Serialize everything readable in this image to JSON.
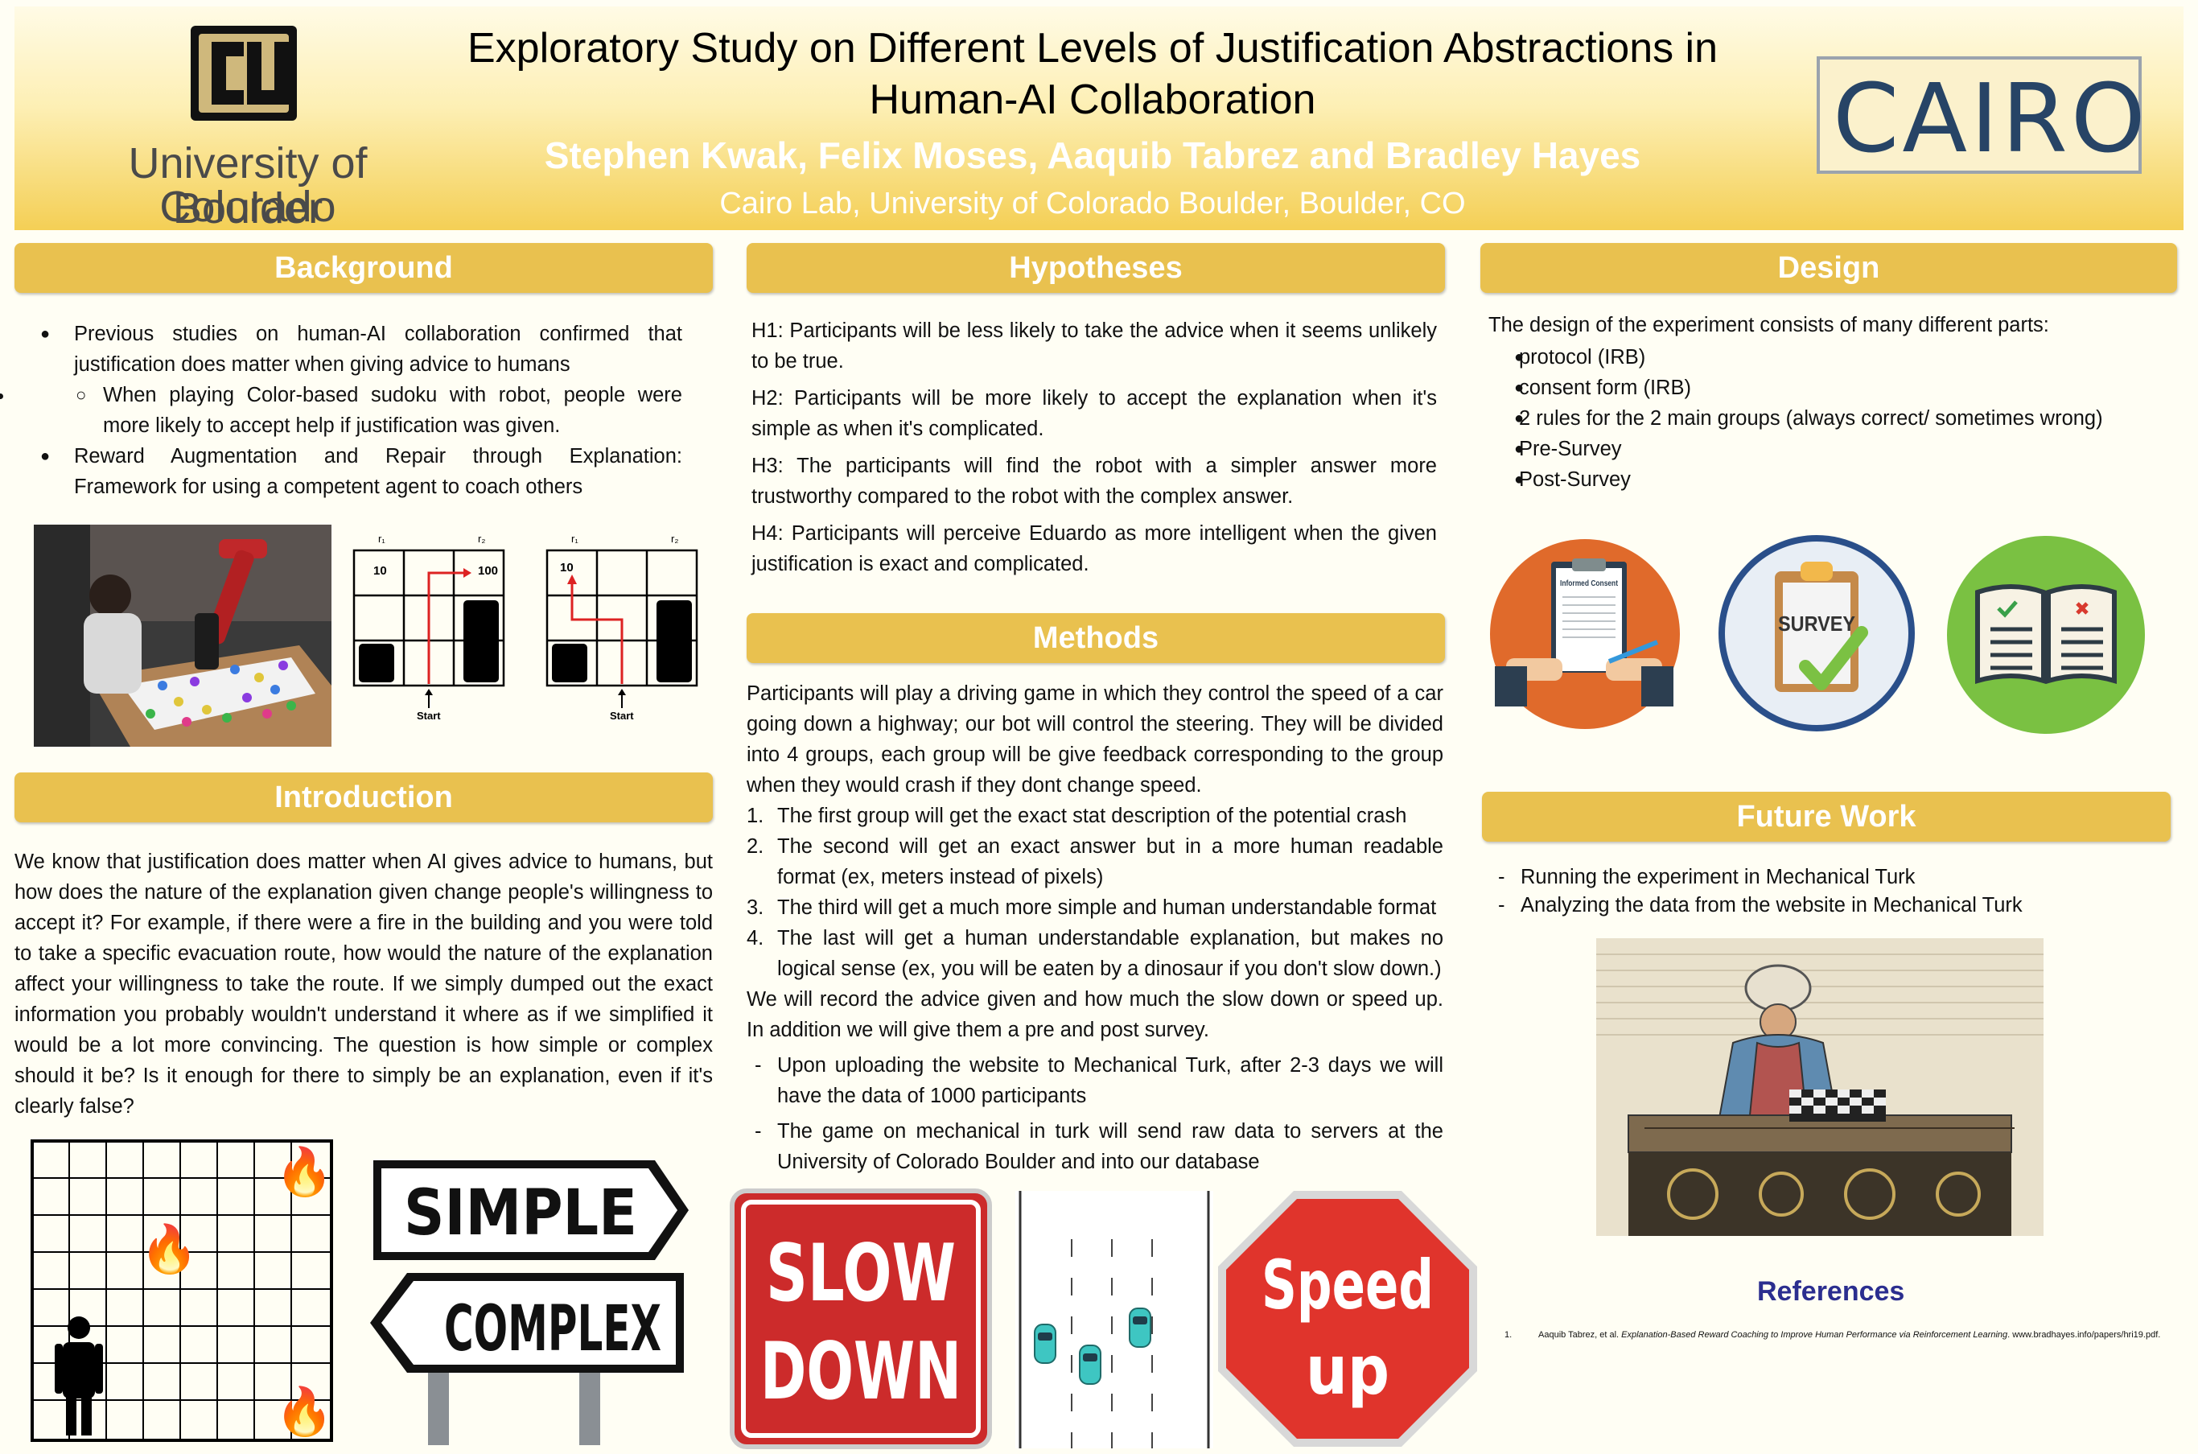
{
  "header": {
    "title": "Exploratory Study on Different Levels of Justification Abstractions in Human-AI Collaboration",
    "authors": "Stephen Kwak, Felix Moses, Aaquib Tabrez and Bradley Hayes",
    "affiliation": "Cairo Lab, University of Colorado Boulder, Boulder, CO",
    "left_logo_line1": "University of Colorado",
    "left_logo_line2": "Boulder",
    "right_logo": "CAIRO"
  },
  "background": {
    "heading": "Background",
    "bullet1": "Previous studies on human-AI collaboration confirmed that justification does matter when giving advice to humans",
    "sub1": "When playing Color-based sudoku with robot, people were more likely to accept help if justification was given.",
    "bullet2": "Reward Augmentation and Repair through Explanation: Framework for using a competent agent to coach others",
    "grid_labels": {
      "r1": "r₁",
      "r2": "r₂",
      "v10": "10",
      "v100": "100",
      "start": "Start"
    }
  },
  "introduction": {
    "heading": "Introduction",
    "text": "We know that justification does matter when AI gives advice to humans, but how does the nature of the explanation given change people's willingness to accept it? For example, if there were a fire in the building and you were told to take a specific evacuation route, how would the nature of the explanation affect your willingness to take the route. If we simply dumped out the exact information you probably wouldn't understand it where as if we simplified it would be a lot more convincing. The question is how simple or complex should it be? Is it enough for there to simply be an explanation, even if it's clearly false?",
    "sign_simple": "SIMPLE",
    "sign_complex": "COMPLEX",
    "fire_glyph": "🔥"
  },
  "hypotheses": {
    "heading": "Hypotheses",
    "items": [
      "H1: Participants will be less likely to take the advice when it seems unlikely to be true.",
      "H2: Participants will be more likely to accept the explanation when it's simple as when it's complicated.",
      "H3: The participants will find the robot with a simpler answer more trustworthy compared to the robot with the complex answer.",
      "H4: Participants will perceive Eduardo as more intelligent when the given justification is exact and complicated."
    ]
  },
  "methods": {
    "heading": "Methods",
    "intro": "Participants will play a driving game in which they control the speed of a car going down a highway; our bot will control the steering. They will be divided into 4 groups, each group will be give feedback corresponding to the group when they would crash if they dont change speed.",
    "list": [
      "The first group will get the exact stat description of the potential crash",
      "The second will get an exact answer but in a more human readable format (ex, meters instead of pixels)",
      "The third will get a much more simple and human understandable format",
      "The last will get a human understandable explanation, but makes no logical sense (ex, you will be eaten by a dinosaur if you don't slow down.)"
    ],
    "list_numbers": [
      "1.",
      "2.",
      "3.",
      "4."
    ],
    "after": "We will record the advice given and how much the slow down or speed up. In addition we will give them a pre and post survey.",
    "dashes": [
      "Upon uploading the website to Mechanical Turk, after 2-3 days we will have the data of 1000 participants",
      "The game on mechanical in turk will send raw data to servers at the University of Colorado Boulder  and into our database"
    ],
    "sign_slow_1": "SLOW",
    "sign_slow_2": "DOWN",
    "sign_speed_1": "Speed",
    "sign_speed_2": "up"
  },
  "design": {
    "heading": "Design",
    "intro": "The design of the experiment consists of many different parts:",
    "items": [
      "protocol (IRB)",
      "consent form (IRB)",
      "2 rules for the 2 main groups (always correct/ sometimes wrong)",
      "Pre-Survey",
      "Post-Survey"
    ],
    "icon_consent_label": "Informed Consent",
    "icon_survey_label": "SURVEY"
  },
  "future": {
    "heading": "Future Work",
    "items": [
      "Running the experiment in Mechanical Turk",
      "Analyzing the data from the website in Mechanical Turk"
    ]
  },
  "references": {
    "heading": "References",
    "number": "1.",
    "text_a": "Aaquib Tabrez, et al. ",
    "text_b": "Explanation-Based Reward Coaching to Improve Human Performance via Reinforcement Learning",
    "text_c": ". www.bradhayes.info/papers/hri19.pdf."
  }
}
